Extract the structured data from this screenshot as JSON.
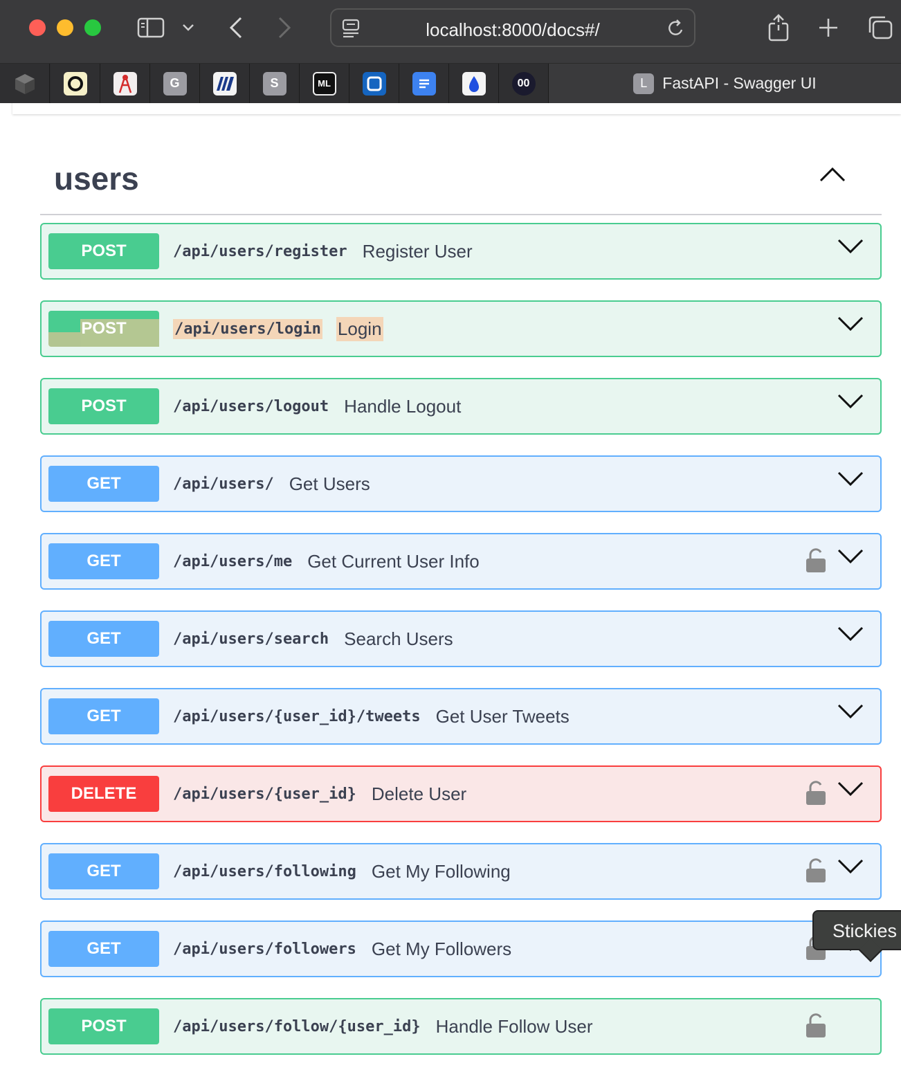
{
  "browser": {
    "url": "localhost:8000/docs#/",
    "active_tab": {
      "favicon_letter": "L",
      "title": "FastAPI - Swagger UI"
    },
    "pinned_tabs": [
      {
        "icon": "dark-cube-icon",
        "letter": ""
      },
      {
        "icon": "ring-logo-icon",
        "letter": ""
      },
      {
        "icon": "tower-logo-icon",
        "letter": ""
      },
      {
        "icon": "g-letter-icon",
        "letter": "G"
      },
      {
        "icon": "stripes-logo-icon",
        "letter": ""
      },
      {
        "icon": "s-letter-icon",
        "letter": "S"
      },
      {
        "icon": "ml-logo-icon",
        "letter": "ML"
      },
      {
        "icon": "square-logo-icon",
        "letter": ""
      },
      {
        "icon": "docs-icon",
        "letter": ""
      },
      {
        "icon": "drop-icon",
        "letter": ""
      },
      {
        "icon": "oo-logo-icon",
        "letter": "00"
      }
    ]
  },
  "section": {
    "title": "users"
  },
  "operations": [
    {
      "method": "POST",
      "path": "/api/users/register",
      "summary": "Register User",
      "locked": false
    },
    {
      "method": "POST",
      "path": "/api/users/login",
      "summary": "Login",
      "locked": false
    },
    {
      "method": "POST",
      "path": "/api/users/logout",
      "summary": "Handle Logout",
      "locked": false
    },
    {
      "method": "GET",
      "path": "/api/users/",
      "summary": "Get Users",
      "locked": false
    },
    {
      "method": "GET",
      "path": "/api/users/me",
      "summary": "Get Current User Info",
      "locked": true
    },
    {
      "method": "GET",
      "path": "/api/users/search",
      "summary": "Search Users",
      "locked": false
    },
    {
      "method": "GET",
      "path": "/api/users/{user_id}/tweets",
      "summary": "Get User Tweets",
      "locked": false
    },
    {
      "method": "DELETE",
      "path": "/api/users/{user_id}",
      "summary": "Delete User",
      "locked": true
    },
    {
      "method": "GET",
      "path": "/api/users/following",
      "summary": "Get My Following",
      "locked": true
    },
    {
      "method": "GET",
      "path": "/api/users/followers",
      "summary": "Get My Followers",
      "locked": true
    },
    {
      "method": "POST",
      "path": "/api/users/follow/{user_id}",
      "summary": "Handle Follow User",
      "locked": true
    }
  ],
  "tooltip": {
    "text": "Stickies"
  },
  "colors": {
    "post": "#49cc90",
    "get": "#61affe",
    "delete": "#f93e3e"
  }
}
